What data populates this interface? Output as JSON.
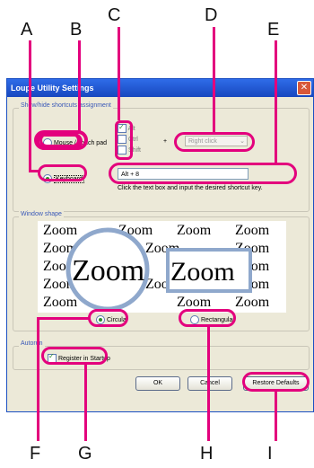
{
  "callouts": {
    "top": [
      "A",
      "B",
      "C",
      "D",
      "E"
    ],
    "bottom": [
      "F",
      "G",
      "H",
      "I"
    ]
  },
  "window": {
    "title": "Loupe Utility Settings",
    "close_glyph": "✕"
  },
  "shortcuts": {
    "group_title": "Show/hide shortcuts assignment",
    "mouse_label": "Mouse / Touch pad",
    "keyboard_label": "Keyboard",
    "modifier_alt": "Alt",
    "modifier_ctrl": "Ctrl",
    "modifier_shift": "Shift",
    "plus": "+",
    "mouse_button_value": "Right click",
    "shortcut_value": "Alt + 8",
    "hint": "Click the text box and input the desired shortcut key."
  },
  "window_shape": {
    "group_title": "Window shape",
    "sample_word": "Zoom",
    "circular_label": "Circular",
    "rectangular_label": "Rectangular"
  },
  "autorun": {
    "group_title": "Autorun",
    "register_label": "Register in Startup"
  },
  "buttons": {
    "ok": "OK",
    "cancel": "Cancel",
    "restore": "Restore Defaults"
  },
  "colors": {
    "callout": "#e3007d",
    "title_bar": "#1f56d6"
  }
}
